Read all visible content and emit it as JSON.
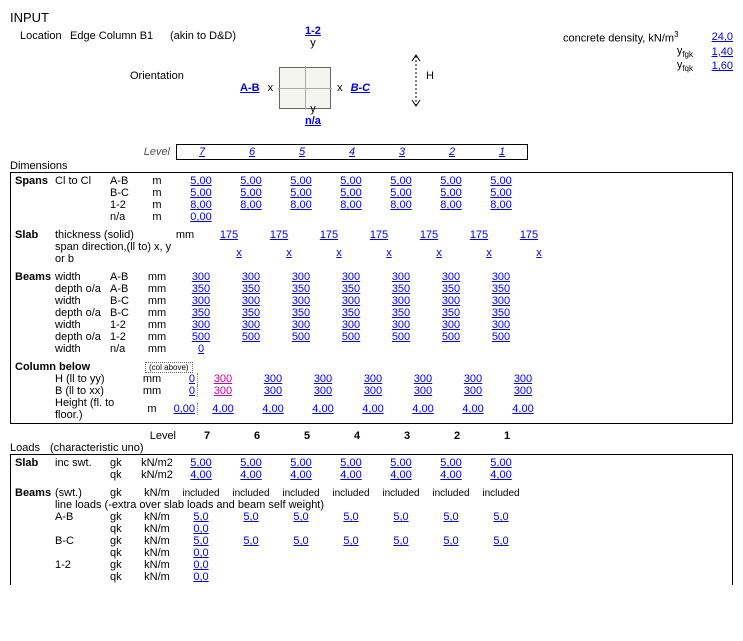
{
  "title": "INPUT",
  "location": {
    "label": "Location",
    "value": "Edge Column B1",
    "note": "(akin to D&D)"
  },
  "orientation": {
    "label": "Orientation",
    "left": "A-B",
    "right": "B-C",
    "top": "1-2",
    "bottom": "n/a",
    "x": "x",
    "y": "y",
    "H": "H"
  },
  "density": {
    "label": "concrete density, kN/m",
    "value": "24,0"
  },
  "yfgk1": {
    "label": "y",
    "sub": "fgk",
    "value": "1,40"
  },
  "yfgk2": {
    "label": "y",
    "sub": "fqk",
    "value": "1,60"
  },
  "levelLabel": "Level",
  "levels": [
    "7",
    "6",
    "5",
    "4",
    "3",
    "2",
    "1"
  ],
  "dimensions": {
    "title": "Dimensions",
    "rows": [
      {
        "g": "Spans",
        "s": "Cl to Cl",
        "n": "A-B",
        "u": "m",
        "v": [
          "5,00",
          "5,00",
          "5,00",
          "5,00",
          "5,00",
          "5,00",
          "5,00"
        ]
      },
      {
        "g": "",
        "s": "",
        "n": "B-C",
        "u": "m",
        "v": [
          "5,00",
          "5,00",
          "5,00",
          "5,00",
          "5,00",
          "5,00",
          "5,00"
        ]
      },
      {
        "g": "",
        "s": "",
        "n": "1-2",
        "u": "m",
        "v": [
          "8,00",
          "8,00",
          "8,00",
          "8,00",
          "8,00",
          "8,00",
          "8,00"
        ]
      },
      {
        "g": "",
        "s": "",
        "n": "n/a",
        "u": "m",
        "v": [
          "0,00",
          "",
          "",
          "",
          "",
          "",
          ""
        ]
      }
    ],
    "slab": {
      "g": "Slab",
      "s": "thickness (solid)",
      "u": "mm",
      "v": [
        "175",
        "175",
        "175",
        "175",
        "175",
        "175",
        "175"
      ]
    },
    "slab2": {
      "s": "span direction,(ll to) x, y or b",
      "v": [
        "x",
        "x",
        "x",
        "x",
        "x",
        "x",
        "x"
      ]
    },
    "beams": [
      {
        "g": "Beams",
        "s": "width",
        "n": "A-B",
        "u": "mm",
        "v": [
          "300",
          "300",
          "300",
          "300",
          "300",
          "300",
          "300"
        ]
      },
      {
        "g": "",
        "s": "depth o/a",
        "n": "A-B",
        "u": "mm",
        "v": [
          "350",
          "350",
          "350",
          "350",
          "350",
          "350",
          "350"
        ]
      },
      {
        "g": "",
        "s": "width",
        "n": "B-C",
        "u": "mm",
        "v": [
          "300",
          "300",
          "300",
          "300",
          "300",
          "300",
          "300"
        ]
      },
      {
        "g": "",
        "s": "depth o/a",
        "n": "B-C",
        "u": "mm",
        "v": [
          "350",
          "350",
          "350",
          "350",
          "350",
          "350",
          "350"
        ]
      },
      {
        "g": "",
        "s": "width",
        "n": "1-2",
        "u": "mm",
        "v": [
          "300",
          "300",
          "300",
          "300",
          "300",
          "300",
          "300"
        ]
      },
      {
        "g": "",
        "s": "depth o/a",
        "n": "1-2",
        "u": "mm",
        "v": [
          "500",
          "500",
          "500",
          "500",
          "500",
          "500",
          "500"
        ]
      },
      {
        "g": "",
        "s": "width",
        "n": "n/a",
        "u": "mm",
        "v": [
          "0",
          "",
          "",
          "",
          "",
          "",
          ""
        ]
      }
    ],
    "col": {
      "title": "Column below",
      "note": "(col above)",
      "rows": [
        {
          "s": "H (ll to yy)",
          "u": "mm",
          "p": "0",
          "v": [
            "300",
            "300",
            "300",
            "300",
            "300",
            "300",
            "300"
          ],
          "mag": true
        },
        {
          "s": "B (ll to xx)",
          "u": "mm",
          "p": "0",
          "v": [
            "300",
            "300",
            "300",
            "300",
            "300",
            "300",
            "300"
          ],
          "mag": true
        },
        {
          "s": "Height (fl. to floor.)",
          "u": "m",
          "p": "0,00",
          "v": [
            "4,00",
            "4,00",
            "4,00",
            "4,00",
            "4,00",
            "4,00",
            "4,00"
          ]
        }
      ]
    }
  },
  "loads": {
    "title": "Loads",
    "note": "(characteristic uno)",
    "levelLabel": "Level",
    "levels": [
      "7",
      "6",
      "5",
      "4",
      "3",
      "2",
      "1"
    ],
    "slab": [
      {
        "g": "Slab",
        "s": "inc swt.",
        "n": "gk",
        "u": "kN/m2",
        "v": [
          "5,00",
          "5,00",
          "5,00",
          "5,00",
          "5,00",
          "5,00",
          "5,00"
        ]
      },
      {
        "g": "",
        "s": "",
        "n": "qk",
        "u": "kN/m2",
        "v": [
          "4,00",
          "4,00",
          "4,00",
          "4,00",
          "4,00",
          "4,00",
          "4,00"
        ]
      }
    ],
    "beams": {
      "g": "Beams",
      "s": "(swt.)",
      "n": "gk",
      "u": "kN/m",
      "v": [
        "included",
        "included",
        "included",
        "included",
        "included",
        "included",
        "included"
      ]
    },
    "note2": "line loads (-extra over slab loads and beam self weight)",
    "lines": [
      {
        "s": "A-B",
        "n": "gk",
        "u": "kN/m",
        "v": [
          "5,0",
          "5,0",
          "5,0",
          "5,0",
          "5,0",
          "5,0",
          "5,0"
        ]
      },
      {
        "s": "",
        "n": "qk",
        "u": "kN/m",
        "v": [
          "0,0",
          "",
          "",
          "",
          "",
          "",
          ""
        ]
      },
      {
        "s": "B-C",
        "n": "gk",
        "u": "kN/m",
        "v": [
          "5,0",
          "5,0",
          "5,0",
          "5,0",
          "5,0",
          "5,0",
          "5,0"
        ]
      },
      {
        "s": "",
        "n": "qk",
        "u": "kN/m",
        "v": [
          "0,0",
          "",
          "",
          "",
          "",
          "",
          ""
        ]
      },
      {
        "s": "1-2",
        "n": "gk",
        "u": "kN/m",
        "v": [
          "0,0",
          "",
          "",
          "",
          "",
          "",
          ""
        ]
      },
      {
        "s": "",
        "n": "qk",
        "u": "kN/m",
        "v": [
          "0,0",
          "",
          "",
          "",
          "",
          "",
          ""
        ]
      }
    ]
  }
}
